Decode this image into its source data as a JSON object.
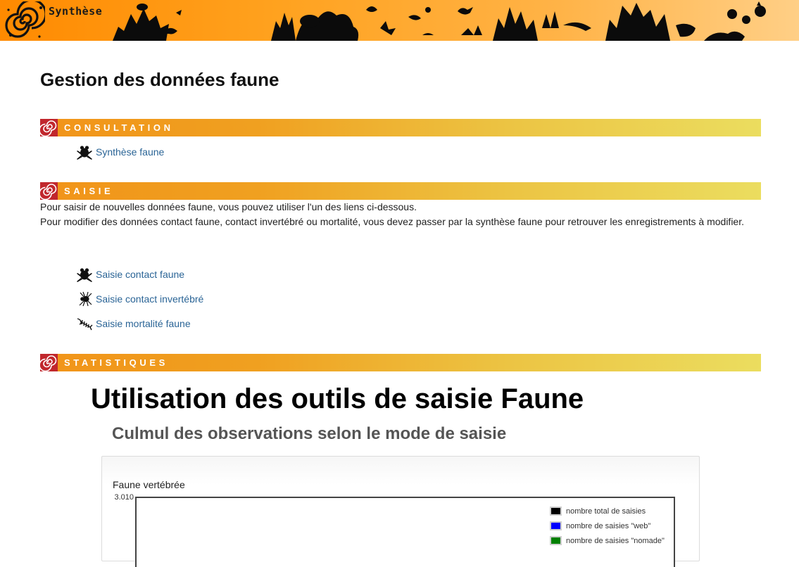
{
  "header": {
    "app_title": "Synthèse"
  },
  "page": {
    "title": "Gestion des données faune"
  },
  "sections": {
    "consultation": {
      "title": "CONSULTATION",
      "links": [
        {
          "label": "Synthèse faune",
          "icon": "frog-icon"
        }
      ]
    },
    "saisie": {
      "title": "SAISIE",
      "intro_line1": "Pour saisir de nouvelles données faune, vous pouvez utiliser l'un des liens ci-dessous.",
      "intro_line2": "Pour modifier des données contact faune, contact invertébré ou mortalité, vous devez passer par la synthèse faune pour retrouver les enregistrements à modifier.",
      "links": [
        {
          "label": "Saisie contact faune",
          "icon": "frog-icon"
        },
        {
          "label": "Saisie contact invertébré",
          "icon": "spider-icon"
        },
        {
          "label": "Saisie mortalité faune",
          "icon": "fish-skeleton-icon"
        }
      ]
    },
    "statistiques": {
      "title": "STATISTIQUES",
      "heading": "Utilisation des outils de saisie Faune",
      "subheading": "Culmul des observations selon le mode de saisie"
    }
  },
  "chart_data": {
    "type": "line",
    "title": "Faune vertébrée",
    "yticks_visible": [
      "3.010"
    ],
    "series": [
      {
        "name": "nombre total de saisies",
        "color": "#000000",
        "values": []
      },
      {
        "name": "nombre de saisies \"web\"",
        "color": "#0000ff",
        "values": []
      },
      {
        "name": "nombre de saisies \"nomade\"",
        "color": "#008000",
        "values": []
      }
    ],
    "legend_position": "top-right"
  },
  "colors": {
    "section_bar_start": "#f19419",
    "section_bar_end": "#ebdd5f",
    "section_icon": "#c1272d",
    "link": "#2a6496"
  }
}
